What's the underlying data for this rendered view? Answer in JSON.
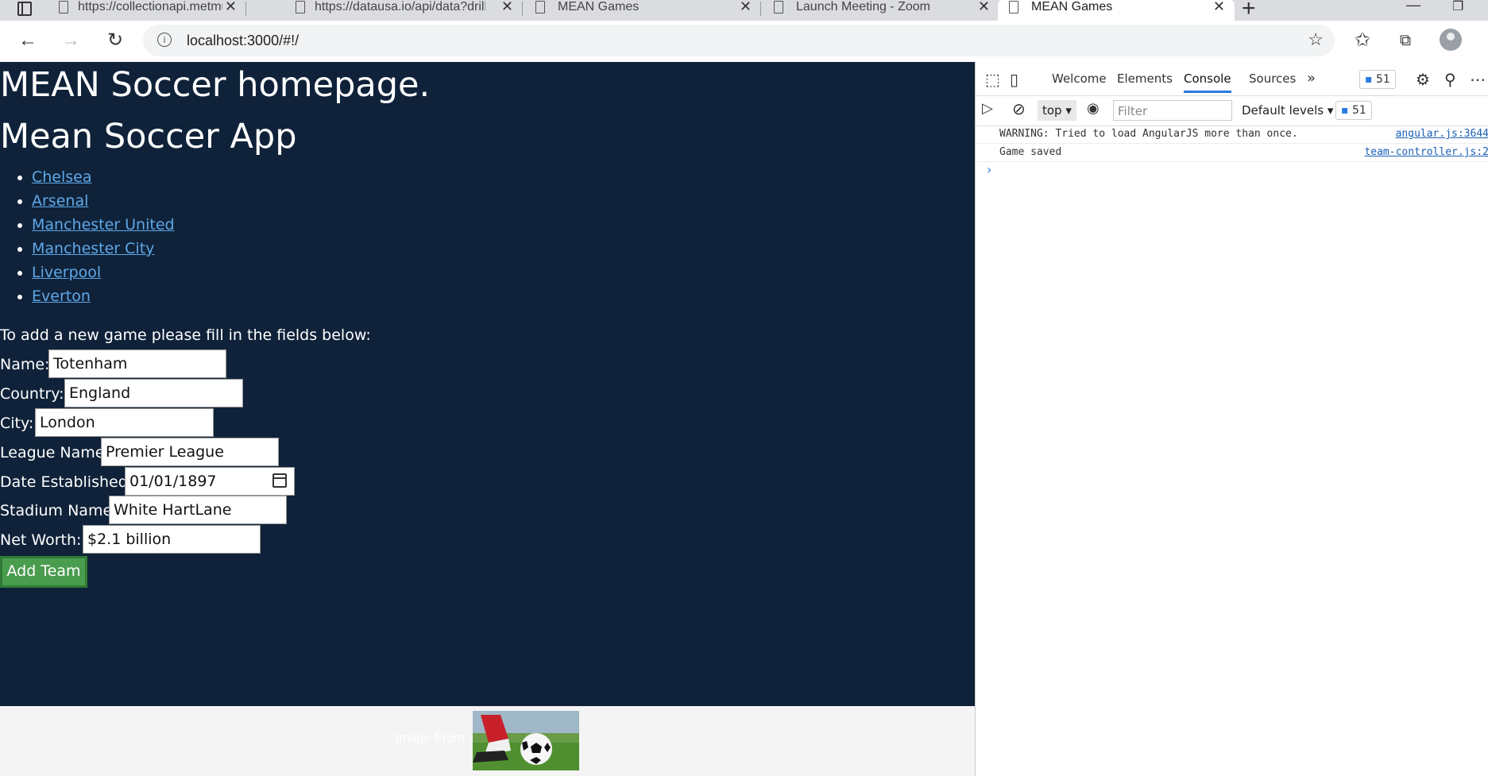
{
  "browser": {
    "tabs": [
      {
        "title": "https://collectionapi.metmuseum",
        "active": false
      },
      {
        "title": "https://datausa.io/api/data?drilld",
        "active": false
      },
      {
        "title": "MEAN Games",
        "active": false
      },
      {
        "title": "Launch Meeting - Zoom",
        "active": false
      },
      {
        "title": "MEAN Games",
        "active": true
      }
    ],
    "url": "localhost:3000/#!/"
  },
  "page": {
    "heading1": "MEAN Soccer homepage.",
    "heading2": "Mean Soccer App",
    "teams": [
      "Chelsea",
      "Arsenal",
      "Manchester United",
      "Manchester City",
      "Liverpool",
      "Everton"
    ],
    "intro": "To add a new game please fill in the fields below:",
    "form": {
      "name": {
        "label": "Name:",
        "value": "Totenham"
      },
      "country": {
        "label": "Country:",
        "value": "England"
      },
      "city": {
        "label": "City:",
        "value": "London"
      },
      "league": {
        "label": "League Name:",
        "value": "Premier League"
      },
      "date": {
        "label": "Date Established:",
        "value": "01/01/1897"
      },
      "stadium": {
        "label": "Stadium Name:",
        "value": "White HartLane"
      },
      "networth": {
        "label": "Net Worth:",
        "value": "$2.1 billion"
      }
    },
    "submit_label": "Add Team",
    "footer_text": "Image From"
  },
  "devtools": {
    "tabs": [
      "Welcome",
      "Elements",
      "Console",
      "Sources"
    ],
    "active_tab": "Console",
    "badge_count": "51",
    "context": "top",
    "filter_placeholder": "Filter",
    "levels": "Default levels",
    "logs": [
      {
        "message": "WARNING: Tried to load AngularJS more than once.",
        "source": "angular.js:3644"
      },
      {
        "message": "Game saved",
        "source": "team-controller.js:2"
      }
    ]
  },
  "colors": {
    "page_bg": "#0f2239",
    "link": "#5fa8e8",
    "button": "#4a9c4e",
    "devtools_accent": "#2a7ae2"
  }
}
